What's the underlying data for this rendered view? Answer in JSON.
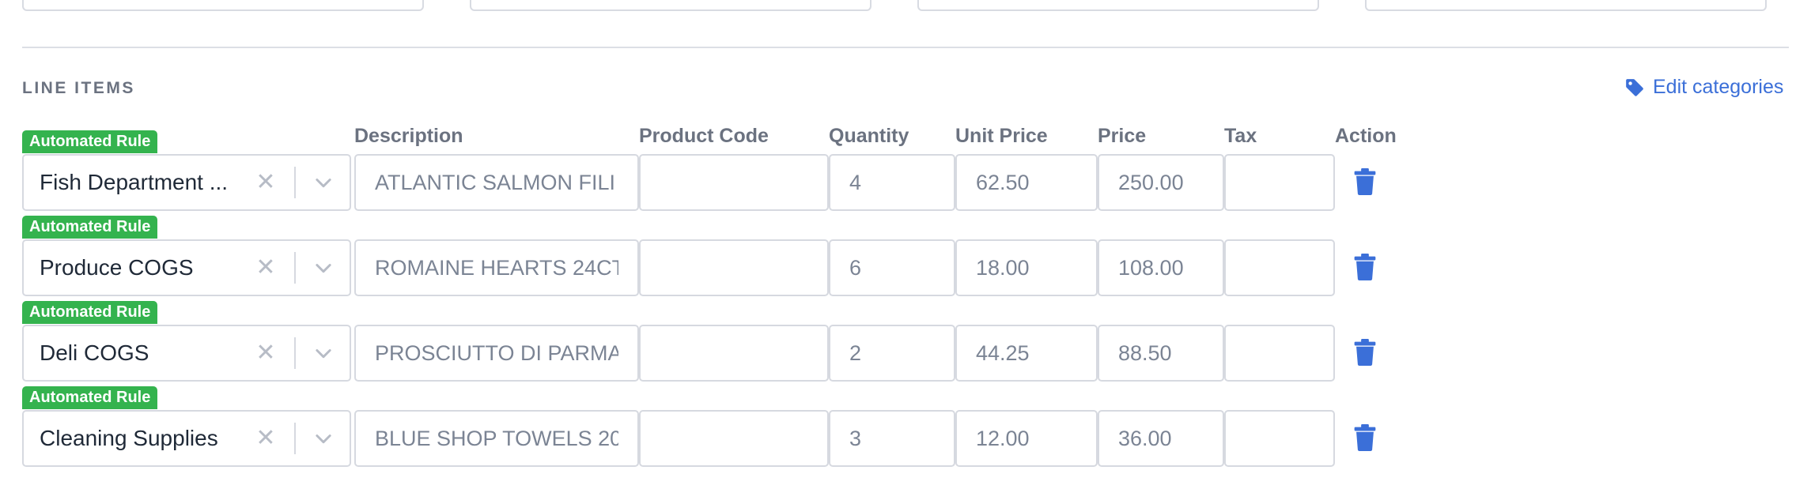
{
  "section": {
    "title": "LINE ITEMS",
    "edit_label": "Edit categories"
  },
  "columns": {
    "description": "Description",
    "product_code": "Product Code",
    "quantity": "Quantity",
    "unit_price": "Unit Price",
    "price": "Price",
    "tax": "Tax",
    "action": "Action"
  },
  "rows": [
    {
      "badge": "Automated Rule",
      "category": "Fish Department ...",
      "description": "ATLANTIC SALMON FILI",
      "product_code": "",
      "quantity": "4",
      "unit_price": "62.50",
      "price": "250.00",
      "tax": ""
    },
    {
      "badge": "Automated Rule",
      "category": "Produce COGS",
      "description": "ROMAINE HEARTS 24CT",
      "product_code": "",
      "quantity": "6",
      "unit_price": "18.00",
      "price": "108.00",
      "tax": ""
    },
    {
      "badge": "Automated Rule",
      "category": "Deli COGS",
      "description": "PROSCIUTTO DI PARMA",
      "product_code": "",
      "quantity": "2",
      "unit_price": "44.25",
      "price": "88.50",
      "tax": ""
    },
    {
      "badge": "Automated Rule",
      "category": "Cleaning Supplies",
      "description": "BLUE SHOP TOWELS 20",
      "product_code": "",
      "quantity": "3",
      "unit_price": "12.00",
      "price": "36.00",
      "tax": ""
    }
  ],
  "icons": {
    "edit": "tag-icon",
    "clear": "clear-x-icon",
    "dropdown": "chevron-down-icon",
    "delete": "trash-icon"
  },
  "colors": {
    "accent": "#3b6fd8",
    "badge": "#34b34e",
    "border": "#d6d9e0",
    "muted_text": "#6b7280"
  }
}
